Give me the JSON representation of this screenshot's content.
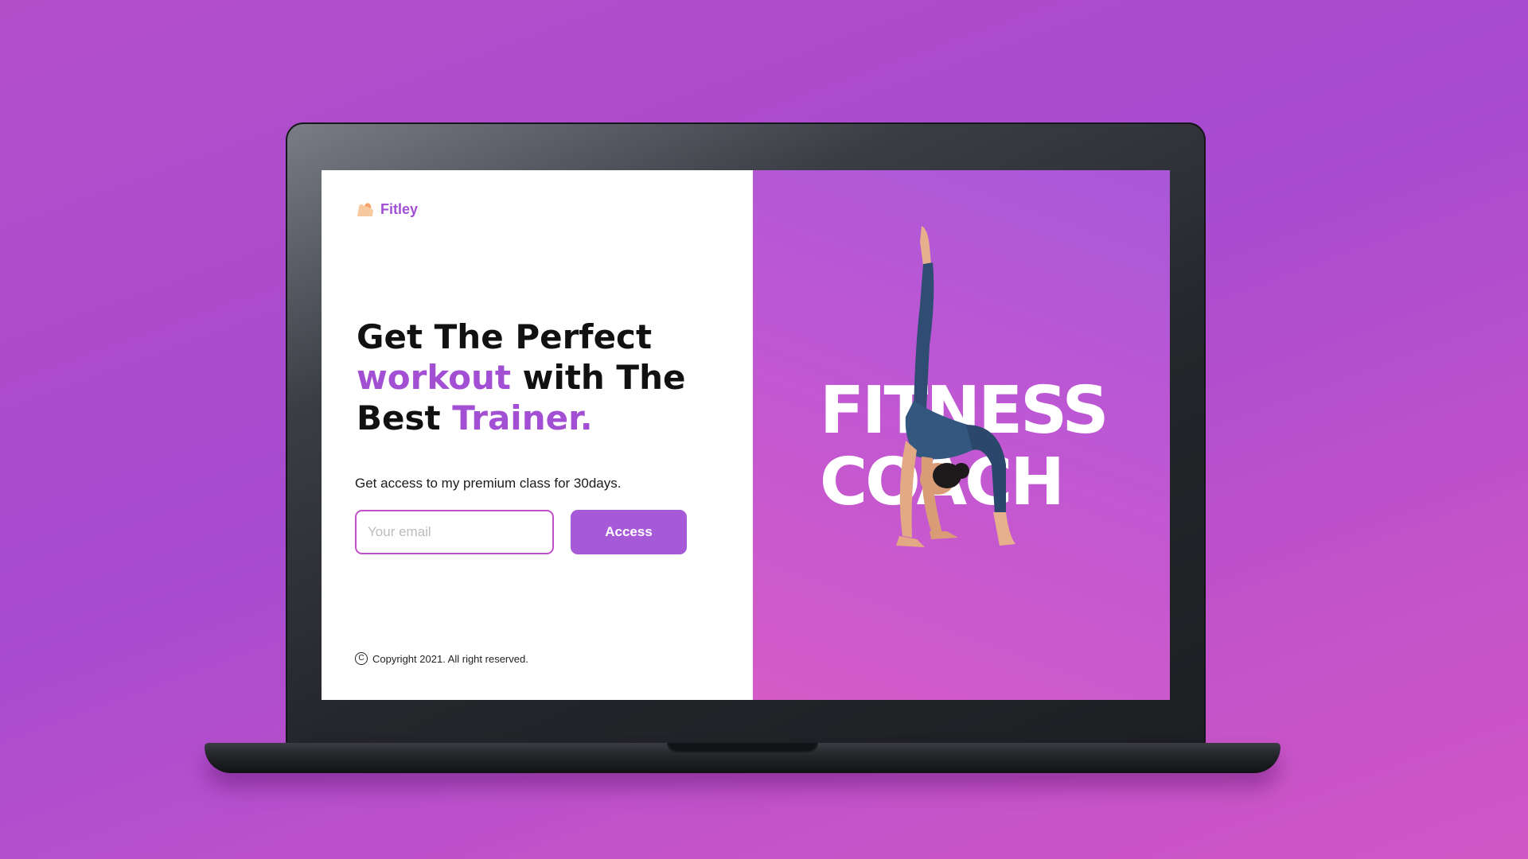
{
  "brand": {
    "name": "Fitley",
    "icon": "flexed-arm-icon"
  },
  "hero_left": {
    "headline_line1": "Get The Perfect",
    "headline_accent1": "workout",
    "headline_line2_rest": " with The",
    "headline_line3_start": "Best ",
    "headline_accent2": "Trainer."
  },
  "subtext": "Get access to my premium class for 30days.",
  "form": {
    "email_placeholder": "Your email",
    "button_label": "Access"
  },
  "footer": {
    "copyright": "Copyright 2021. All right reserved.",
    "icon": "copyright-icon"
  },
  "hero_right": {
    "title_line1": "FITNESS",
    "title_line2": "COACH"
  },
  "colors": {
    "accent": "#a24fd4",
    "button": "#a65ad8",
    "input_border": "#c24fc7"
  }
}
